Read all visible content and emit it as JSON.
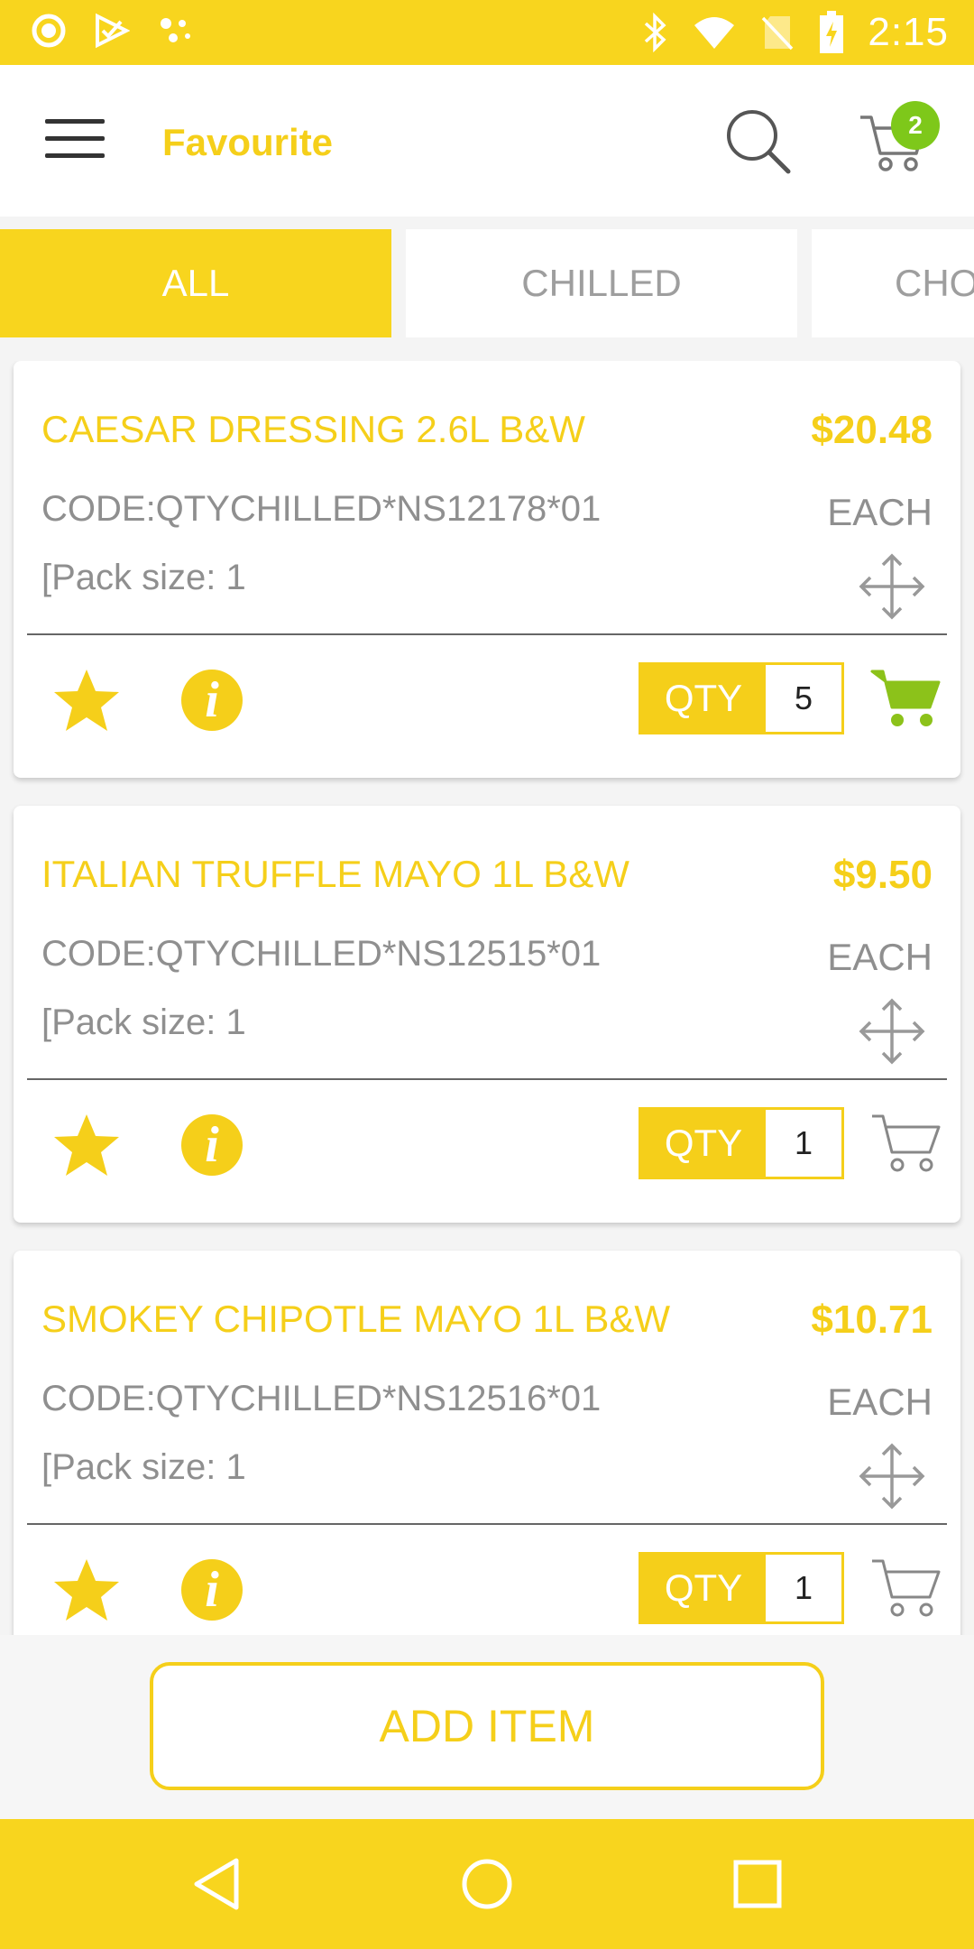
{
  "status_bar": {
    "time": "2:15",
    "icons": [
      "record-icon",
      "check-flag-icon",
      "dots-icon",
      "bluetooth-icon",
      "wifi-icon",
      "no-sim-icon",
      "battery-icon"
    ]
  },
  "app_bar": {
    "title": "Favourite",
    "cart_count": "2",
    "icons": [
      "menu-icon",
      "search-icon",
      "cart-icon"
    ]
  },
  "tabs": [
    {
      "label": "ALL",
      "active": true
    },
    {
      "label": "CHILLED",
      "active": false
    },
    {
      "label": "CHO",
      "active": false
    }
  ],
  "products": [
    {
      "name": "CAESAR DRESSING 2.6L B&W",
      "price": "$20.48",
      "code": "CODE:QTYCHILLED*NS12178*01",
      "unit": "EACH",
      "pack": "[Pack size: 1",
      "qty_label": "QTY",
      "qty": "5",
      "in_cart": true
    },
    {
      "name": "ITALIAN TRUFFLE MAYO 1L B&W",
      "price": "$9.50",
      "code": "CODE:QTYCHILLED*NS12515*01",
      "unit": "EACH",
      "pack": "[Pack size: 1",
      "qty_label": "QTY",
      "qty": "1",
      "in_cart": false
    },
    {
      "name": "SMOKEY CHIPOTLE MAYO 1L B&W",
      "price": "$10.71",
      "code": "CODE:QTYCHILLED*NS12516*01",
      "unit": "EACH",
      "pack": "[Pack size: 1",
      "qty_label": "QTY",
      "qty": "1",
      "in_cart": false
    }
  ],
  "footer": {
    "add_item_label": "ADD ITEM"
  },
  "info_glyph": "i",
  "colors": {
    "accent": "#f8d51e",
    "accent_text": "#f5cf1a",
    "cart_active": "#8cc21a",
    "badge": "#7ec81a",
    "muted_text": "#8f8f8f"
  }
}
